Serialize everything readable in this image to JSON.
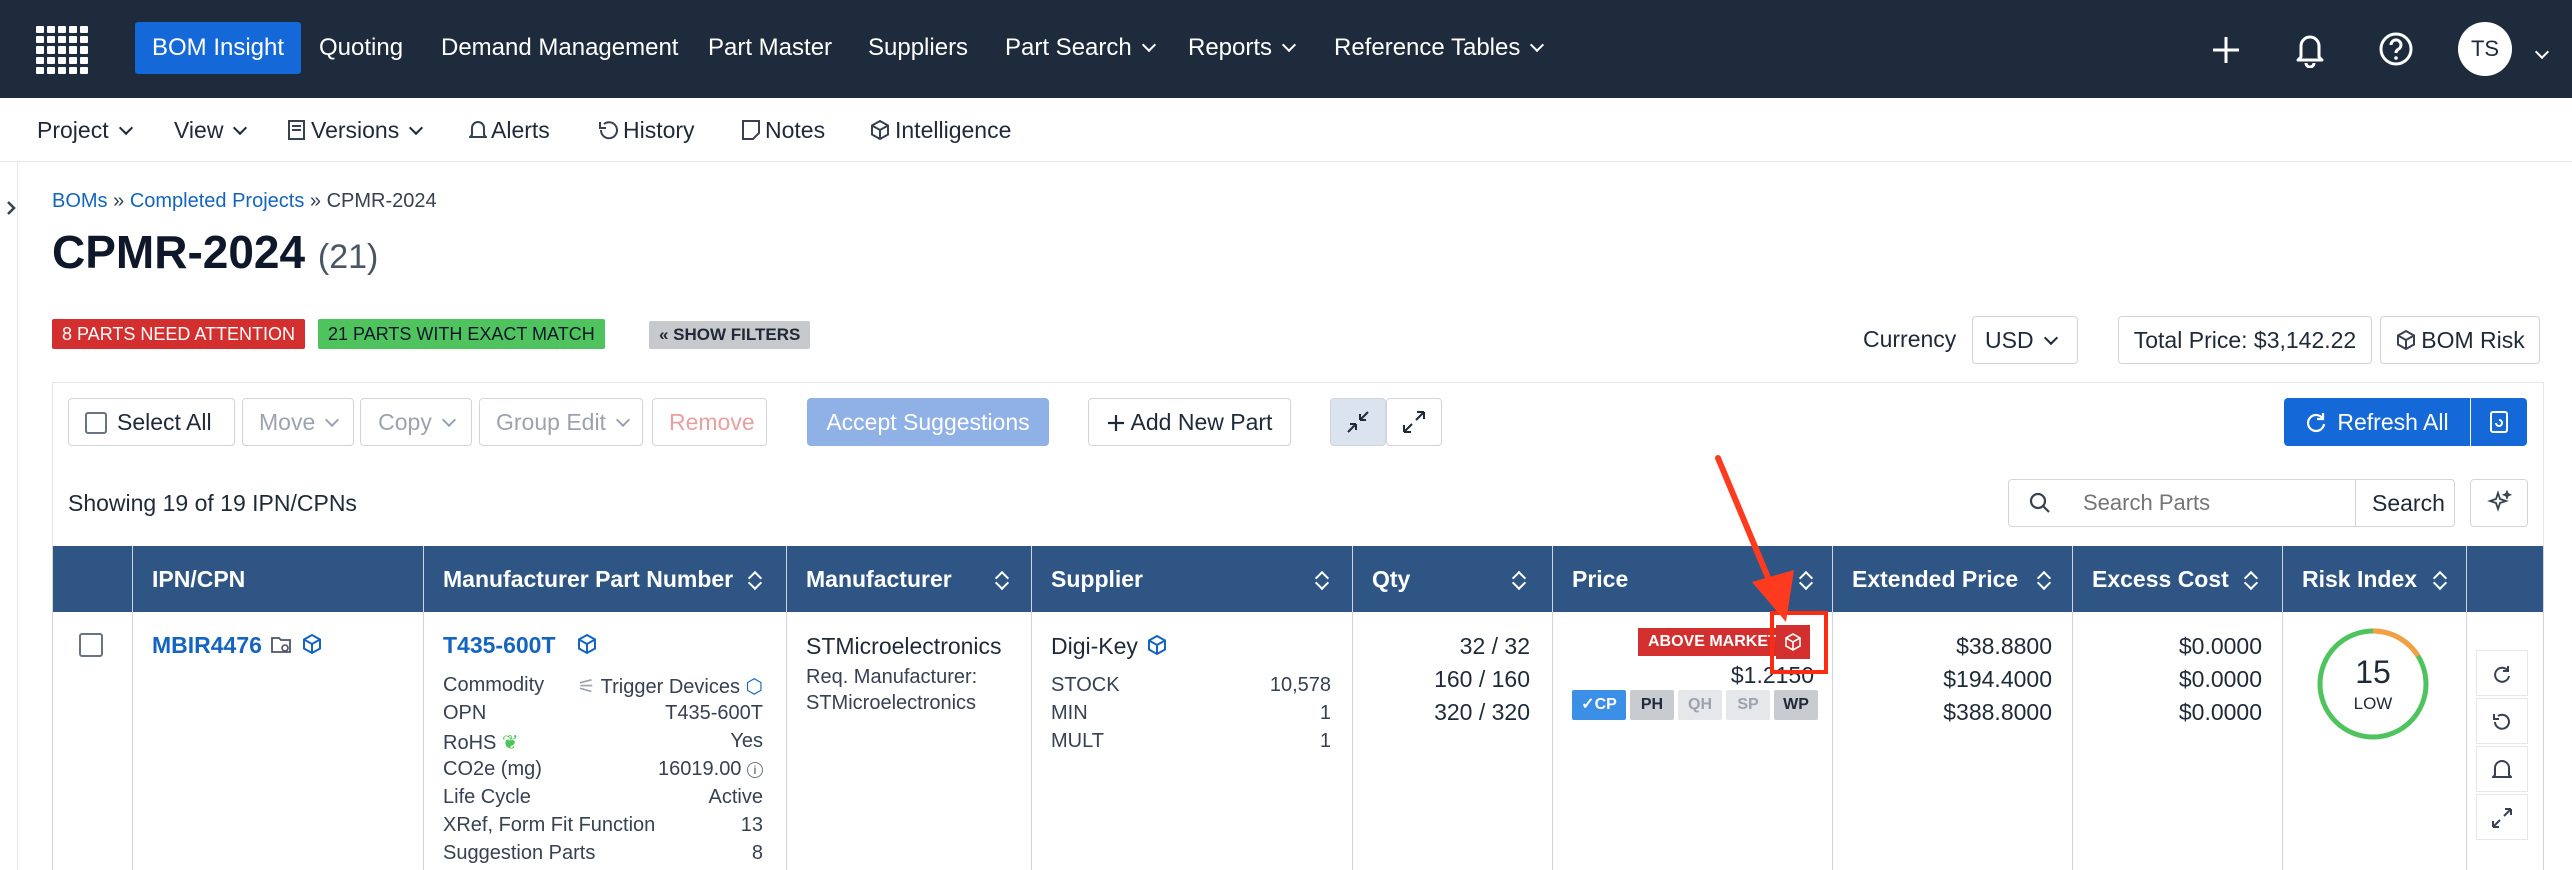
{
  "nav": {
    "items": [
      "BOM Insight",
      "Quoting",
      "Demand Management",
      "Part Master",
      "Suppliers",
      "Part Search",
      "Reports",
      "Reference Tables"
    ],
    "avatar": "TS"
  },
  "subnav": {
    "items": [
      "Project",
      "View",
      "Versions",
      "Alerts",
      "History",
      "Notes",
      "Intelligence"
    ]
  },
  "breadcrumb": {
    "root": "BOMs",
    "sep1": "»",
    "parent": "Completed Projects",
    "sep2": "»",
    "current": "CPMR-2024"
  },
  "page": {
    "title": "CPMR-2024",
    "count": "(21)"
  },
  "badges": {
    "attention": "8 PARTS NEED ATTENTION",
    "exact": "21 PARTS WITH EXACT MATCH",
    "filters": "« SHOW FILTERS"
  },
  "summary": {
    "currency_label": "Currency",
    "currency_value": "USD",
    "total_price": "Total Price: $3,142.22",
    "bom_risk": "BOM Risk"
  },
  "toolbar": {
    "select_all": "Select All",
    "move": "Move",
    "copy": "Copy",
    "group_edit": "Group Edit",
    "remove": "Remove",
    "accept": "Accept Suggestions",
    "add_part": "Add New Part",
    "refresh": "Refresh All"
  },
  "list": {
    "showing": "Showing 19 of 19 IPN/CPNs",
    "search_placeholder": "Search Parts",
    "search_button": "Search"
  },
  "table": {
    "headers": [
      "IPN/CPN",
      "Manufacturer Part Number",
      "Manufacturer",
      "Supplier",
      "Qty",
      "Price",
      "Extended Price",
      "Excess Cost",
      "Risk Index"
    ],
    "row": {
      "ipn": "MBIR4476",
      "mpn": "T435-600T",
      "mpn_details": [
        {
          "k": "Commodity",
          "v": "Trigger Devices"
        },
        {
          "k": "OPN",
          "v": "T435-600T"
        },
        {
          "k": "RoHS",
          "v": "Yes"
        },
        {
          "k": "CO2e (mg)",
          "v": "16019.00"
        },
        {
          "k": "Life Cycle",
          "v": "Active"
        },
        {
          "k": "XRef, Form Fit Function",
          "v": "13"
        },
        {
          "k": "Suggestion Parts",
          "v": "8"
        }
      ],
      "manufacturer": "STMicroelectronics",
      "req_mfr_label": "Req. Manufacturer:",
      "req_mfr_value": "STMicroelectronics",
      "supplier": "Digi-Key",
      "supplier_details": [
        {
          "k": "STOCK",
          "v": "10,578"
        },
        {
          "k": "MIN",
          "v": "1"
        },
        {
          "k": "MULT",
          "v": "1"
        }
      ],
      "qty": [
        "32 / 32",
        "160 / 160",
        "320 / 320"
      ],
      "price_badge": "ABOVE MARKET",
      "price": "$1.2150",
      "price_chips": [
        "✓CP",
        "PH",
        "QH",
        "SP",
        "WP"
      ],
      "extended": [
        "$38.8800",
        "$194.4000",
        "$388.8000"
      ],
      "excess": [
        "$0.0000",
        "$0.0000",
        "$0.0000"
      ],
      "risk_value": "15",
      "risk_label": "LOW"
    }
  },
  "colors": {
    "nav_bg": "#1e2b3c",
    "accent": "#1468d8",
    "table_header": "#2f5584",
    "danger": "#d32f2f",
    "success": "#4fc35d"
  }
}
